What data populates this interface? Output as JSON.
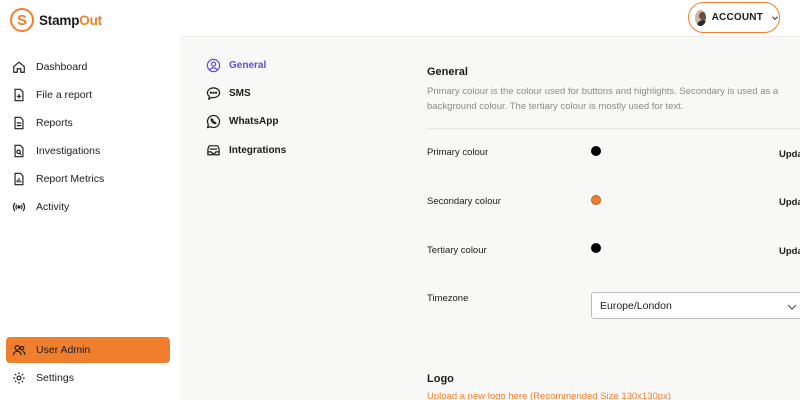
{
  "brand": {
    "prefix": "Stamp",
    "suffix": "Out",
    "mark": "S"
  },
  "sidebar": {
    "items": [
      {
        "label": "Dashboard",
        "icon": "home-icon"
      },
      {
        "label": "File a report",
        "icon": "file-plus-icon"
      },
      {
        "label": "Reports",
        "icon": "document-icon"
      },
      {
        "label": "Investigations",
        "icon": "file-search-icon"
      },
      {
        "label": "Report Metrics",
        "icon": "chart-document-icon"
      },
      {
        "label": "Activity",
        "icon": "broadcast-icon"
      }
    ],
    "bottom_items": [
      {
        "label": "User Admin",
        "icon": "users-icon",
        "active": true
      },
      {
        "label": "Settings",
        "icon": "gear-icon"
      }
    ]
  },
  "header": {
    "account_label": "ACCOUNT"
  },
  "settings_nav": [
    {
      "label": "General",
      "icon": "user-circle-icon",
      "active": true
    },
    {
      "label": "SMS",
      "icon": "chat-bubble-icon"
    },
    {
      "label": "WhatsApp",
      "icon": "whatsapp-icon"
    },
    {
      "label": "Integrations",
      "icon": "inbox-stack-icon"
    }
  ],
  "general": {
    "title": "General",
    "description_line1": "Primary colour is the colour used for buttons and highlights. Secondary is used as a",
    "description_line2": "background colour. The tertiary colour is mostly used for text.",
    "colours": [
      {
        "label": "Primary colour",
        "value": "#000000",
        "action": "Update"
      },
      {
        "label": "Secondary colour",
        "value": "#f07f2d",
        "action": "Update"
      },
      {
        "label": "Tertiary colour",
        "value": "#000000",
        "action": "Update"
      }
    ],
    "timezone_label": "Timezone",
    "timezone_value": "Europe/London"
  },
  "logo": {
    "title": "Logo",
    "upload_link": "Upload a new logo here (Recommended Size 130x130px)"
  },
  "colors": {
    "accent": "#f07f2d",
    "active_subnav": "#5b4fd8"
  }
}
